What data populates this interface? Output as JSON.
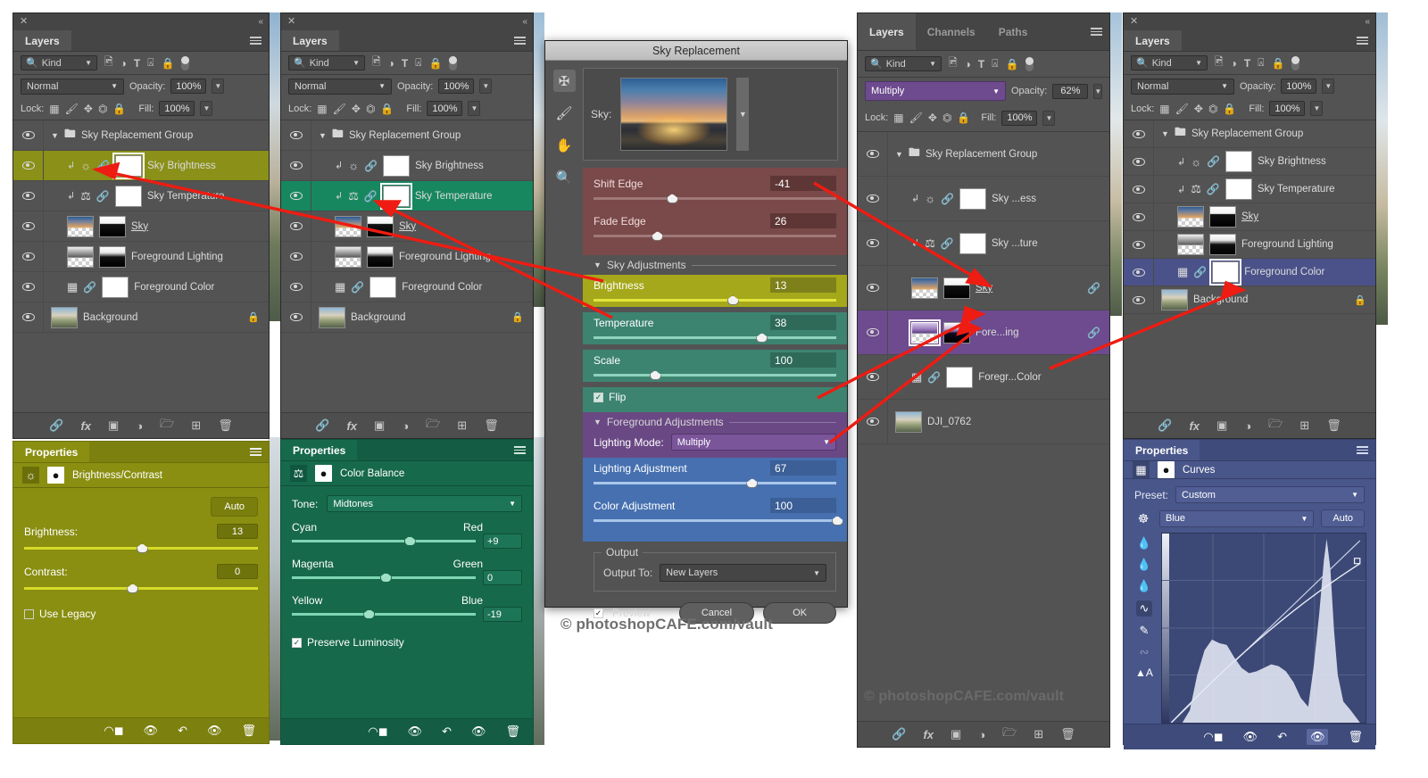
{
  "watermarks": [
    {
      "text": "© photoshopCAFE.com/vault"
    },
    {
      "text": "© photoshopCAFE.com/vault"
    }
  ],
  "common": {
    "panel_title_layers": "Layers",
    "kind_label": "Kind",
    "opacity_label": "Opacity:",
    "lock_label": "Lock:",
    "fill_label": "Fill:",
    "properties_title": "Properties",
    "auto_label": "Auto"
  },
  "panel1": {
    "tab": "Layers",
    "kind": "Kind",
    "blend_mode": "Normal",
    "opacity": "100%",
    "fill": "100%",
    "layers": [
      {
        "name": "Sky Replacement Group",
        "type": "group",
        "indent": 0,
        "selected": false
      },
      {
        "name": "Sky Brightness",
        "type": "adjustment",
        "icon": "brightness-icon",
        "indent": 1,
        "selected": true,
        "highlight": "olive",
        "clipped": true,
        "linked_mask": true
      },
      {
        "name": "Sky Temperature",
        "type": "adjustment",
        "icon": "color-balance-icon",
        "indent": 1,
        "selected": false,
        "clipped": true,
        "linked_mask": true
      },
      {
        "name": "Sky",
        "type": "pixel",
        "indent": 1,
        "selected": false,
        "underline": true,
        "thumb": "sky-thumb",
        "mask": "sky-mask"
      },
      {
        "name": "Foreground Lighting",
        "type": "pixel",
        "indent": 1,
        "selected": false,
        "thumb": "fg-light-thumb",
        "mask": "fg-light-mask"
      },
      {
        "name": "Foreground Color",
        "type": "curves",
        "icon": "curves-icon",
        "indent": 1,
        "selected": false,
        "linked_mask": true
      },
      {
        "name": "Background",
        "type": "background",
        "indent": 0,
        "selected": false,
        "locked": true
      }
    ],
    "properties": {
      "tab": "Properties",
      "adjustment_name": "Brightness/Contrast",
      "auto": "Auto",
      "fields": [
        {
          "label": "Brightness:",
          "value": "13",
          "knob_pct": 50
        },
        {
          "label": "Contrast:",
          "value": "0",
          "knob_pct": 46
        }
      ],
      "use_legacy": {
        "label": "Use Legacy",
        "checked": false
      }
    },
    "accent": "#8a9018"
  },
  "panel2": {
    "tab": "Layers",
    "kind": "Kind",
    "blend_mode": "Normal",
    "opacity": "100%",
    "fill": "100%",
    "layers": [
      {
        "name": "Sky Replacement Group",
        "type": "group",
        "indent": 0,
        "selected": false
      },
      {
        "name": "Sky Brightness",
        "type": "adjustment",
        "icon": "brightness-icon",
        "indent": 1,
        "selected": false,
        "clipped": true,
        "linked_mask": true
      },
      {
        "name": "Sky Temperature",
        "type": "adjustment",
        "icon": "color-balance-icon",
        "indent": 1,
        "selected": true,
        "highlight": "green",
        "clipped": true,
        "linked_mask": true
      },
      {
        "name": "Sky",
        "type": "pixel",
        "indent": 1,
        "selected": false,
        "underline": true,
        "thumb": "sky-thumb",
        "mask": "sky-mask"
      },
      {
        "name": "Foreground Lighting",
        "type": "pixel",
        "indent": 1,
        "selected": false,
        "thumb": "fg-light-thumb",
        "mask": "fg-light-mask"
      },
      {
        "name": "Foreground Color",
        "type": "curves",
        "icon": "curves-icon",
        "indent": 1,
        "selected": false,
        "linked_mask": true
      },
      {
        "name": "Background",
        "type": "background",
        "indent": 0,
        "selected": false,
        "locked": true
      }
    ],
    "properties": {
      "tab": "Properties",
      "adjustment_name": "Color Balance",
      "tone_label": "Tone:",
      "tone_value": "Midtones",
      "sliders": [
        {
          "left": "Cyan",
          "right": "Red",
          "value": "+9",
          "knob_pct": 61
        },
        {
          "left": "Magenta",
          "right": "Green",
          "value": "0",
          "knob_pct": 48
        },
        {
          "left": "Yellow",
          "right": "Blue",
          "value": "-19",
          "knob_pct": 39
        }
      ],
      "preserve_luminosity": {
        "label": "Preserve Luminosity",
        "checked": true
      }
    },
    "accent": "#17875f"
  },
  "sky_dialog": {
    "title": "Sky Replacement",
    "tools": [
      "move-tool-icon",
      "sky-brush-icon",
      "hand-tool-icon",
      "zoom-tool-icon"
    ],
    "sky_label": "Sky:",
    "edge": [
      {
        "label": "Shift Edge",
        "value": "-41",
        "knob_pct": 30
      },
      {
        "label": "Fade Edge",
        "value": "26",
        "knob_pct": 24
      }
    ],
    "sky_adjustments": {
      "header": "Sky Adjustments",
      "rows": [
        {
          "label": "Brightness",
          "value": "13",
          "knob_pct": 55,
          "accent": "#a5a81a"
        },
        {
          "label": "Temperature",
          "value": "38",
          "knob_pct": 67,
          "accent": "#3d8470"
        },
        {
          "label": "Scale",
          "value": "100",
          "knob_pct": 23,
          "accent": "#3d8470"
        }
      ],
      "flip": {
        "label": "Flip",
        "checked": true
      }
    },
    "foreground_adjustments": {
      "header": "Foreground Adjustments",
      "lighting_mode_label": "Lighting Mode:",
      "lighting_mode_value": "Multiply",
      "rows": [
        {
          "label": "Lighting Adjustment",
          "value": "67",
          "knob_pct": 63
        },
        {
          "label": "Color Adjustment",
          "value": "100",
          "knob_pct": 98
        }
      ]
    },
    "output": {
      "group_label": "Output",
      "output_to_label": "Output To:",
      "output_to_value": "New Layers"
    },
    "preview": {
      "label": "Preview",
      "checked": true
    },
    "cancel": "Cancel",
    "ok": "OK"
  },
  "panel3": {
    "tabs": [
      "Layers",
      "Channels",
      "Paths"
    ],
    "active_tab": "Layers",
    "kind": "Kind",
    "blend_mode": "Multiply",
    "opacity": "62%",
    "fill": "100%",
    "layers": [
      {
        "name": "Sky Replacement Group",
        "type": "group",
        "indent": 0,
        "selected": false
      },
      {
        "name": "Sky ...ess",
        "type": "adjustment",
        "icon": "brightness-icon",
        "indent": 1,
        "selected": false,
        "clipped": true,
        "linked_mask": true
      },
      {
        "name": "Sky ...ture",
        "type": "adjustment",
        "icon": "color-balance-icon",
        "indent": 1,
        "selected": false,
        "clipped": true,
        "linked_mask": true
      },
      {
        "name": "Sky",
        "type": "pixel",
        "indent": 1,
        "selected": false,
        "underline": true,
        "thumb": "sky-thumb",
        "mask": "sky-mask",
        "link_badge": true
      },
      {
        "name": "Fore...ing",
        "type": "pixel",
        "indent": 1,
        "selected": true,
        "highlight": "purple",
        "thumb": "fg-light-thumb",
        "mask": "fg-light-mask",
        "link_badge": true
      },
      {
        "name": "Foregr...Color",
        "type": "curves",
        "icon": "curves-icon",
        "indent": 1,
        "selected": false,
        "linked_mask": true
      },
      {
        "name": "DJI_0762",
        "type": "smart",
        "indent": 0,
        "selected": false
      }
    ],
    "accent": "#6d4b8e"
  },
  "panel4": {
    "tab": "Layers",
    "kind": "Kind",
    "blend_mode": "Normal",
    "opacity": "100%",
    "fill": "100%",
    "layers": [
      {
        "name": "Sky Replacement Group",
        "type": "group",
        "indent": 0,
        "selected": false
      },
      {
        "name": "Sky Brightness",
        "type": "adjustment",
        "icon": "brightness-icon",
        "indent": 1,
        "selected": false,
        "clipped": true,
        "linked_mask": true
      },
      {
        "name": "Sky Temperature",
        "type": "adjustment",
        "icon": "color-balance-icon",
        "indent": 1,
        "selected": false,
        "clipped": true,
        "linked_mask": true
      },
      {
        "name": "Sky",
        "type": "pixel",
        "indent": 1,
        "selected": false,
        "underline": true,
        "thumb": "sky-thumb",
        "mask": "sky-mask"
      },
      {
        "name": "Foreground Lighting",
        "type": "pixel",
        "indent": 1,
        "selected": false,
        "thumb": "fg-light-thumb",
        "mask": "fg-light-mask"
      },
      {
        "name": "Foreground Color",
        "type": "curves",
        "icon": "curves-icon",
        "indent": 1,
        "selected": true,
        "highlight": "blue",
        "linked_mask": true
      },
      {
        "name": "Background",
        "type": "background",
        "indent": 0,
        "selected": false,
        "locked": true
      }
    ],
    "properties": {
      "tab": "Properties",
      "adjustment_name": "Curves",
      "preset_label": "Preset:",
      "preset_value": "Custom",
      "channel_value": "Blue",
      "auto": "Auto"
    },
    "accent": "#4a5289"
  }
}
